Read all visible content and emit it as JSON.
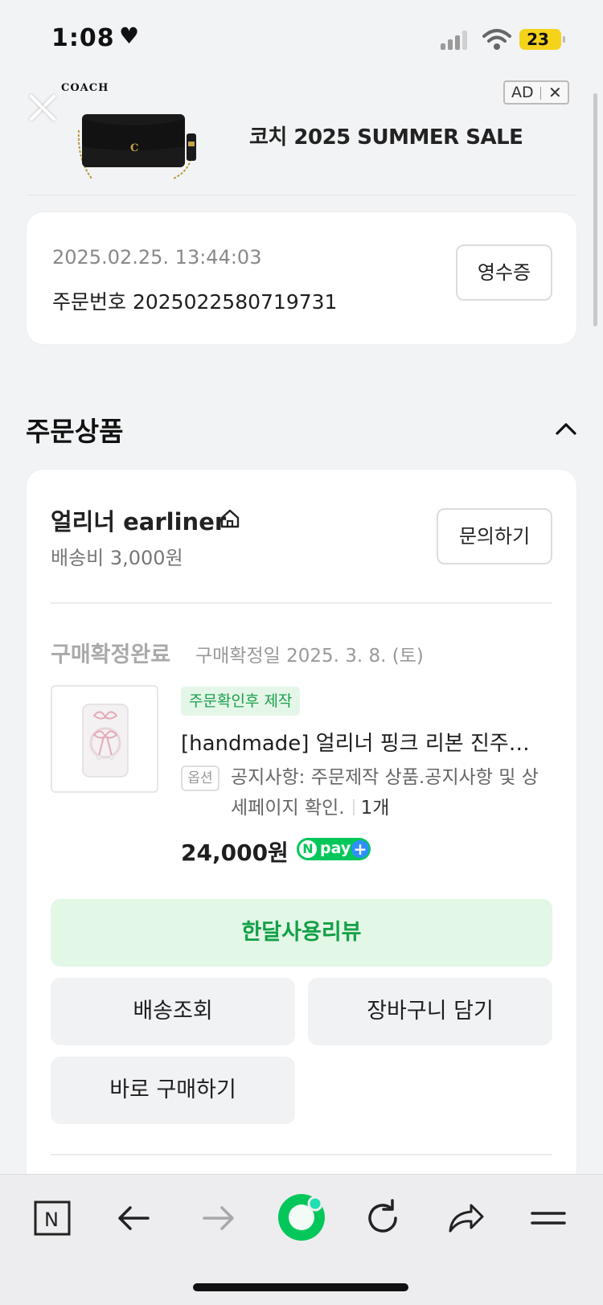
{
  "status_bar": {
    "time": "1:08",
    "battery": "23"
  },
  "ad": {
    "brand": "COACH",
    "title": "코치 2025 SUMMER SALE",
    "tag": "AD",
    "close": "✕"
  },
  "order": {
    "date": "2025.02.25. 13:44:03",
    "number": "주문번호 2025022580719731",
    "receipt_button": "영수증"
  },
  "section": {
    "title": "주문상품"
  },
  "seller": {
    "name": "얼리너 earliner",
    "shipping_fee": "배송비 3,000원",
    "inquiry_button": "문의하기"
  },
  "product": {
    "status": "구매확정완료",
    "confirm_date": "구매확정일 2025. 3. 8. (토)",
    "badge": "주문확인후 제작",
    "name": "[handmade] 얼리너 핑크 리본 진주…",
    "option_label": "옵션",
    "option_text": "공지사항: 주문제작 상품.공지사항 및 상세페이지 확인.",
    "quantity": "1개",
    "price": "24,000원",
    "npay_n": "N",
    "npay_label": "pay",
    "npay_plus": "+"
  },
  "actions": {
    "review": "한달사용리뷰",
    "tracking": "배송조회",
    "cart": "장바구니 담기",
    "buy_now": "바로 구매하기"
  },
  "toolbar": {
    "n_logo": "N"
  },
  "colors": {
    "green_accent": "#03c75a",
    "review_bg": "#e2f7e6",
    "badge_bg": "#e4f6e8",
    "button_gray": "#f1f2f4",
    "page_bg": "#f2f3f5"
  }
}
